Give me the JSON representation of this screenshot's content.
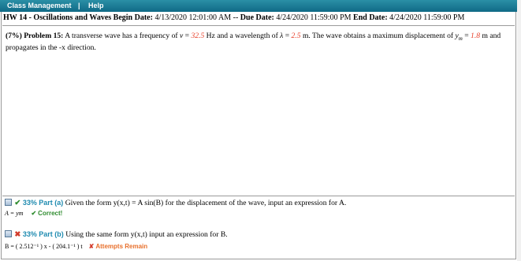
{
  "menu": {
    "class_management": "Class Management",
    "separator": "|",
    "help": "Help"
  },
  "assignment": {
    "name": "HW 14 - Oscillations and Waves",
    "begin_label": "Begin Date:",
    "begin_date": "4/13/2020 12:01:00 AM",
    "dash": "--",
    "due_label": "Due Date:",
    "due_date": "4/24/2020 11:59:00 PM",
    "end_label": "End Date:",
    "end_date": "4/24/2020 11:59:00 PM"
  },
  "problem": {
    "weight": "(7%)",
    "title": "Problem 15:",
    "text_1": "A transverse wave has a frequency of",
    "nu_sym": "ν",
    "nu_val": "32.5",
    "nu_unit": "Hz and a wavelength of",
    "lambda_sym": "λ",
    "lambda_val": "2.5",
    "lambda_unit": "m. The wave obtains a maximum",
    "text_2": "displacement of",
    "ym_val": "1.8",
    "text_3": "m and propagates in the -x direction."
  },
  "parts": [
    {
      "percent": "33%",
      "label": "Part (a)",
      "question": "Given the form y(x,t) = A sin(B) for the displacement of the wave, input an expression for A.",
      "answer": "A = ym",
      "status": "Correct!"
    },
    {
      "percent": "33%",
      "label": "Part (b)",
      "question": "Using the same form y(x,t) input an expression for B.",
      "answer": "B = ( 2.512⁻¹ ) x - ( 204.1⁻¹ ) t",
      "status": "Attempts Remain"
    }
  ],
  "colors": {
    "menu_bar": "#1a7c98",
    "given_value": "#e8412c",
    "percent": "#1f8bb0",
    "correct": "#2e8b2e",
    "attempts": "#e8702c"
  }
}
